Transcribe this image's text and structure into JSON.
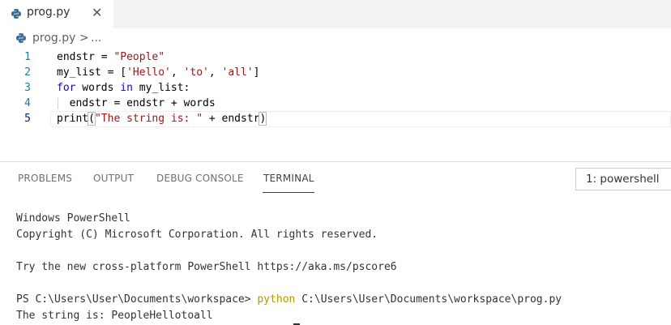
{
  "tab": {
    "filename": "prog.py",
    "close_glyph": "✕",
    "icon": "python-icon"
  },
  "breadcrumb": {
    "file": "prog.py",
    "separator": ">",
    "more": "..."
  },
  "editor": {
    "line_numbers": [
      "1",
      "2",
      "3",
      "4",
      "5"
    ],
    "line1": {
      "var": "endstr = ",
      "str": "\"People\""
    },
    "line2": {
      "prefix": "my_list = [",
      "s1": "'Hello'",
      "c1": ", ",
      "s2": "'to'",
      "c2": ", ",
      "s3": "'all'",
      "suffix": "]"
    },
    "line3": {
      "kw1": "for",
      "mid1": " words ",
      "kw2": "in",
      "rest": " my_list:"
    },
    "line4": {
      "code": "  endstr = endstr + words"
    },
    "line5": {
      "fn": "print",
      "open": "(",
      "str": "\"The string is: \"",
      "rest": " + endstr",
      "close": ")"
    }
  },
  "panel": {
    "tabs": [
      "PROBLEMS",
      "OUTPUT",
      "DEBUG CONSOLE",
      "TERMINAL"
    ],
    "active_tab": "TERMINAL",
    "terminal_select": "1: powershell"
  },
  "terminal": {
    "line1": "Windows PowerShell",
    "line2": "Copyright (C) Microsoft Corporation. All rights reserved.",
    "line3": "Try the new cross-platform PowerShell https://aka.ms/pscore6",
    "prompt": "PS C:\\Users\\User\\Documents\\workspace> ",
    "command": "python",
    "args": " C:\\Users\\User\\Documents\\workspace\\prog.py",
    "output": "The string is: PeopleHellotoall"
  },
  "colors": {
    "keyword": "#0000ff",
    "string": "#a31515",
    "command": "#b59b00",
    "line_number": "#237893"
  }
}
